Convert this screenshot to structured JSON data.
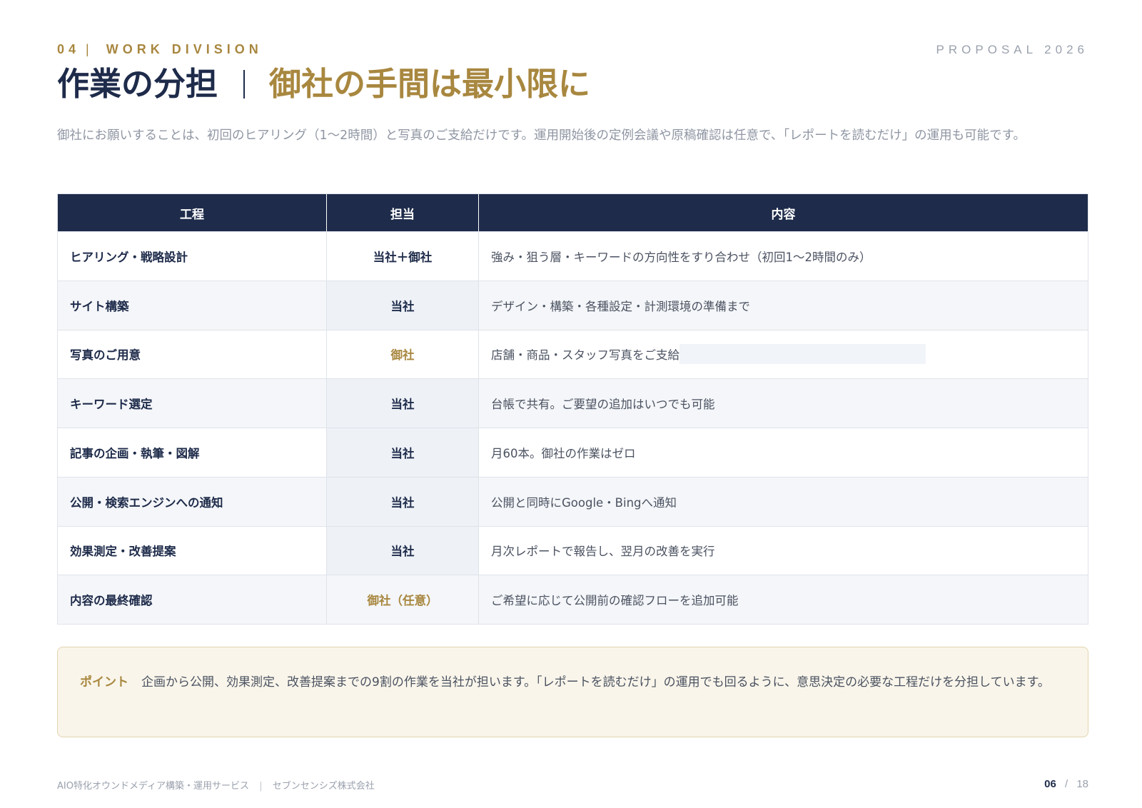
{
  "header": {
    "section_number": "04",
    "section_name": "WORK DIVISION",
    "proposal": "PROPOSAL 2026",
    "title_main": "作業の分担",
    "title_accent": "御社の手間は最小限に",
    "lead": "御社にお願いすることは、初回のヒアリング（1〜2時間）と写真のご支給だけです。運用開始後の定例会議や原稿確認は任意で、「レポートを読むだけ」の運用も可能です。"
  },
  "table": {
    "headers": [
      "工程",
      "担当",
      "内容"
    ],
    "rows": [
      {
        "process": "ヒアリング・戦略設計",
        "owner": "当社＋御社",
        "detail": "強み・狙う層・キーワードの方向性をすり合わせ（初回1〜2時間のみ）"
      },
      {
        "process": "サイト構築",
        "owner": "当社",
        "detail": "デザイン・構築・各種設定・計測環境の準備まで"
      },
      {
        "process": "写真のご用意",
        "owner": "御社",
        "detail": "店舗・商品・スタッフ写真をご支給"
      },
      {
        "process": "キーワード選定",
        "owner": "当社",
        "detail": "台帳で共有。ご要望の追加はいつでも可能"
      },
      {
        "process": "記事の企画・執筆・図解",
        "owner": "当社",
        "detail": "月60本。御社の作業はゼロ"
      },
      {
        "process": "公開・検索エンジンへの通知",
        "owner": "当社",
        "detail": "公開と同時にGoogle・Bingへ通知"
      },
      {
        "process": "効果測定・改善提案",
        "owner": "当社",
        "detail": "月次レポートで報告し、翌月の改善を実行"
      },
      {
        "process": "内容の最終確認",
        "owner": "御社（任意）",
        "detail": "ご希望に応じて公開前の確認フローを追加可能"
      }
    ]
  },
  "point": {
    "label": "ポイント",
    "text": "企画から公開、効果測定、改善提案までの9割の作業を当社が担います。「レポートを読むだけ」の運用でも回るように、意思決定の必要な工程だけを分担しています。"
  },
  "footer": {
    "service": "AIO特化オウンドメディア構築・運用サービス",
    "company": "セブンセンシズ株式会社",
    "page_current": "06",
    "page_total": "18"
  },
  "colors": {
    "navy": "#1e2b4a",
    "gold": "#a8873f",
    "point_bg": "#f9f5ea"
  }
}
